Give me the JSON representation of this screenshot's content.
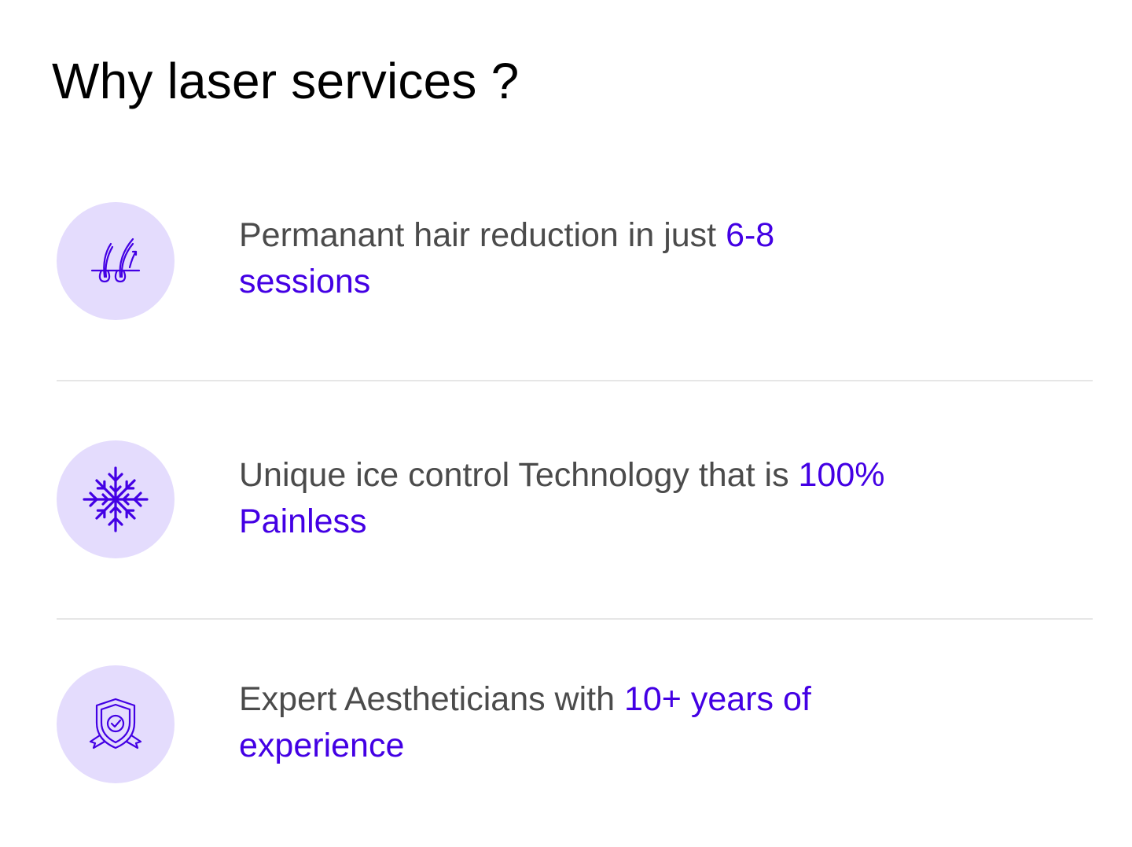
{
  "title": "Why laser services ?",
  "features": [
    {
      "icon": "hair-follicle-icon",
      "text_plain": "Permanant hair reduction in just ",
      "text_highlight": "6-8 sessions"
    },
    {
      "icon": "snowflake-icon",
      "text_plain": "Unique ice control Technology that is ",
      "text_highlight": "100% Painless"
    },
    {
      "icon": "shield-check-icon",
      "text_plain": "Expert Aestheticians with ",
      "text_highlight": "10+ years of experience"
    }
  ],
  "colors": {
    "accent": "#4300e4",
    "icon_bg": "#e4dcfd",
    "body_text": "#4b4b4b",
    "title_text": "#000000",
    "divider": "#e6e6e6"
  }
}
